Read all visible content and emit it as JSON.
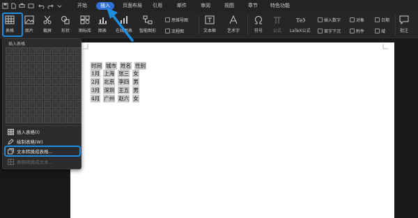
{
  "tabs": [
    "开始",
    "插入",
    "页面布局",
    "引用",
    "邮件",
    "审阅",
    "视图",
    "章节",
    "特色功能"
  ],
  "active_tab": "插入",
  "ribbon": {
    "table": "表格",
    "picture": "图片",
    "screenshot": "截屏",
    "shapes": "形状",
    "icons": "图标库",
    "chart": "图表",
    "online_chart": "在线图表",
    "smart_graphic": "智能图形",
    "mind_map": "思维导图",
    "flowchart": "流程图",
    "textbox": "文本框",
    "wordart": "艺术字",
    "symbol": "符号",
    "formula": "公式",
    "latex": "LaTeX公式",
    "insert_number": "插入数字",
    "drop_cap": "首字下沉",
    "object": "对象",
    "attachment": "附件",
    "date": "日期",
    "field": "域",
    "comment": "批注"
  },
  "dropdown": {
    "title": "插入表格",
    "items": [
      "插入表格(I)",
      "绘制表格(W)",
      "文本转换成表格...",
      "表格转换成文本..."
    ]
  },
  "document_lines": [
    [
      "时间",
      "城市",
      "姓名",
      "性别"
    ],
    [
      "1月",
      "上海",
      "张三",
      "女"
    ],
    [
      "2月",
      "北京",
      "李四",
      "男"
    ],
    [
      "3月",
      "深圳",
      "王五",
      "男"
    ],
    [
      "4月",
      "广州",
      "赵六",
      "女"
    ]
  ],
  "colors": {
    "accent": "#2f6fd6",
    "highlight_outline": "#1e8ee0",
    "page": "#ffffff",
    "background": "#1f1f21"
  }
}
